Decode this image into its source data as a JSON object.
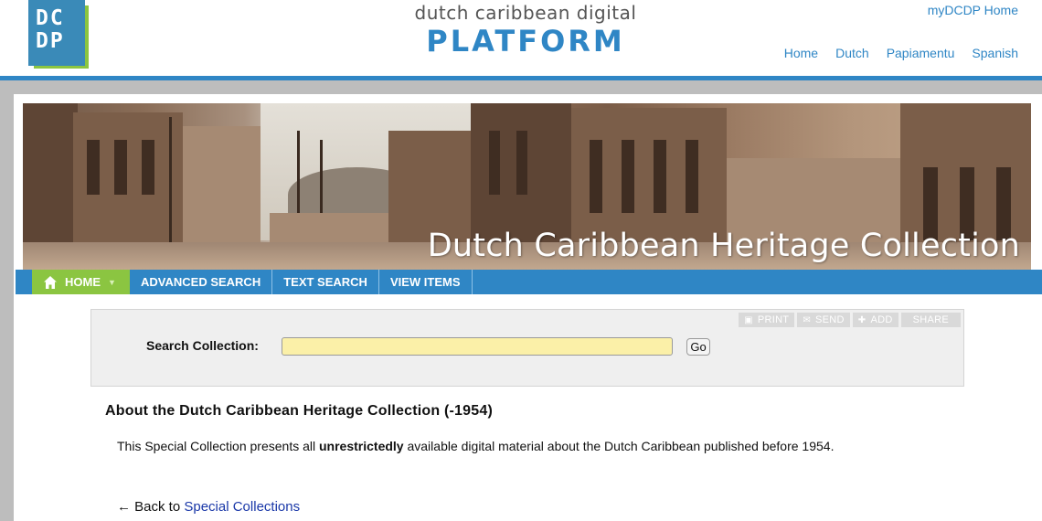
{
  "header": {
    "logo_line1": "DC",
    "logo_line2": "DP",
    "subtitle": "dutch caribbean digital",
    "title": "PLATFORM",
    "mydcdp_link": "myDCDP Home",
    "lang_nav": [
      "Home",
      "Dutch",
      "Papiamentu",
      "Spanish"
    ]
  },
  "banner": {
    "title": "Dutch Caribbean Heritage Collection"
  },
  "nav": {
    "home": "HOME",
    "home_icon": "house-icon",
    "items": [
      "ADVANCED SEARCH",
      "TEXT SEARCH",
      "VIEW ITEMS"
    ]
  },
  "tools": {
    "print": "PRINT",
    "send": "SEND",
    "add": "ADD",
    "share": "SHARE"
  },
  "search": {
    "label": "Search Collection:",
    "value": "",
    "placeholder": "",
    "go_label": "Go"
  },
  "about": {
    "heading": "About the Dutch Caribbean Heritage Collection (-1954)",
    "text_before": "This Special Collection presents all ",
    "text_bold": "unrestrictedly",
    "text_after": " available digital material about the Dutch Caribbean published before 1954.",
    "back_prefix": "← Back to ",
    "back_link": "Special Collections"
  },
  "colors": {
    "brand_blue": "#2f86c5",
    "brand_green": "#8bc541",
    "search_input_bg": "#fbf0a8",
    "link_blue": "#1a38a8"
  }
}
